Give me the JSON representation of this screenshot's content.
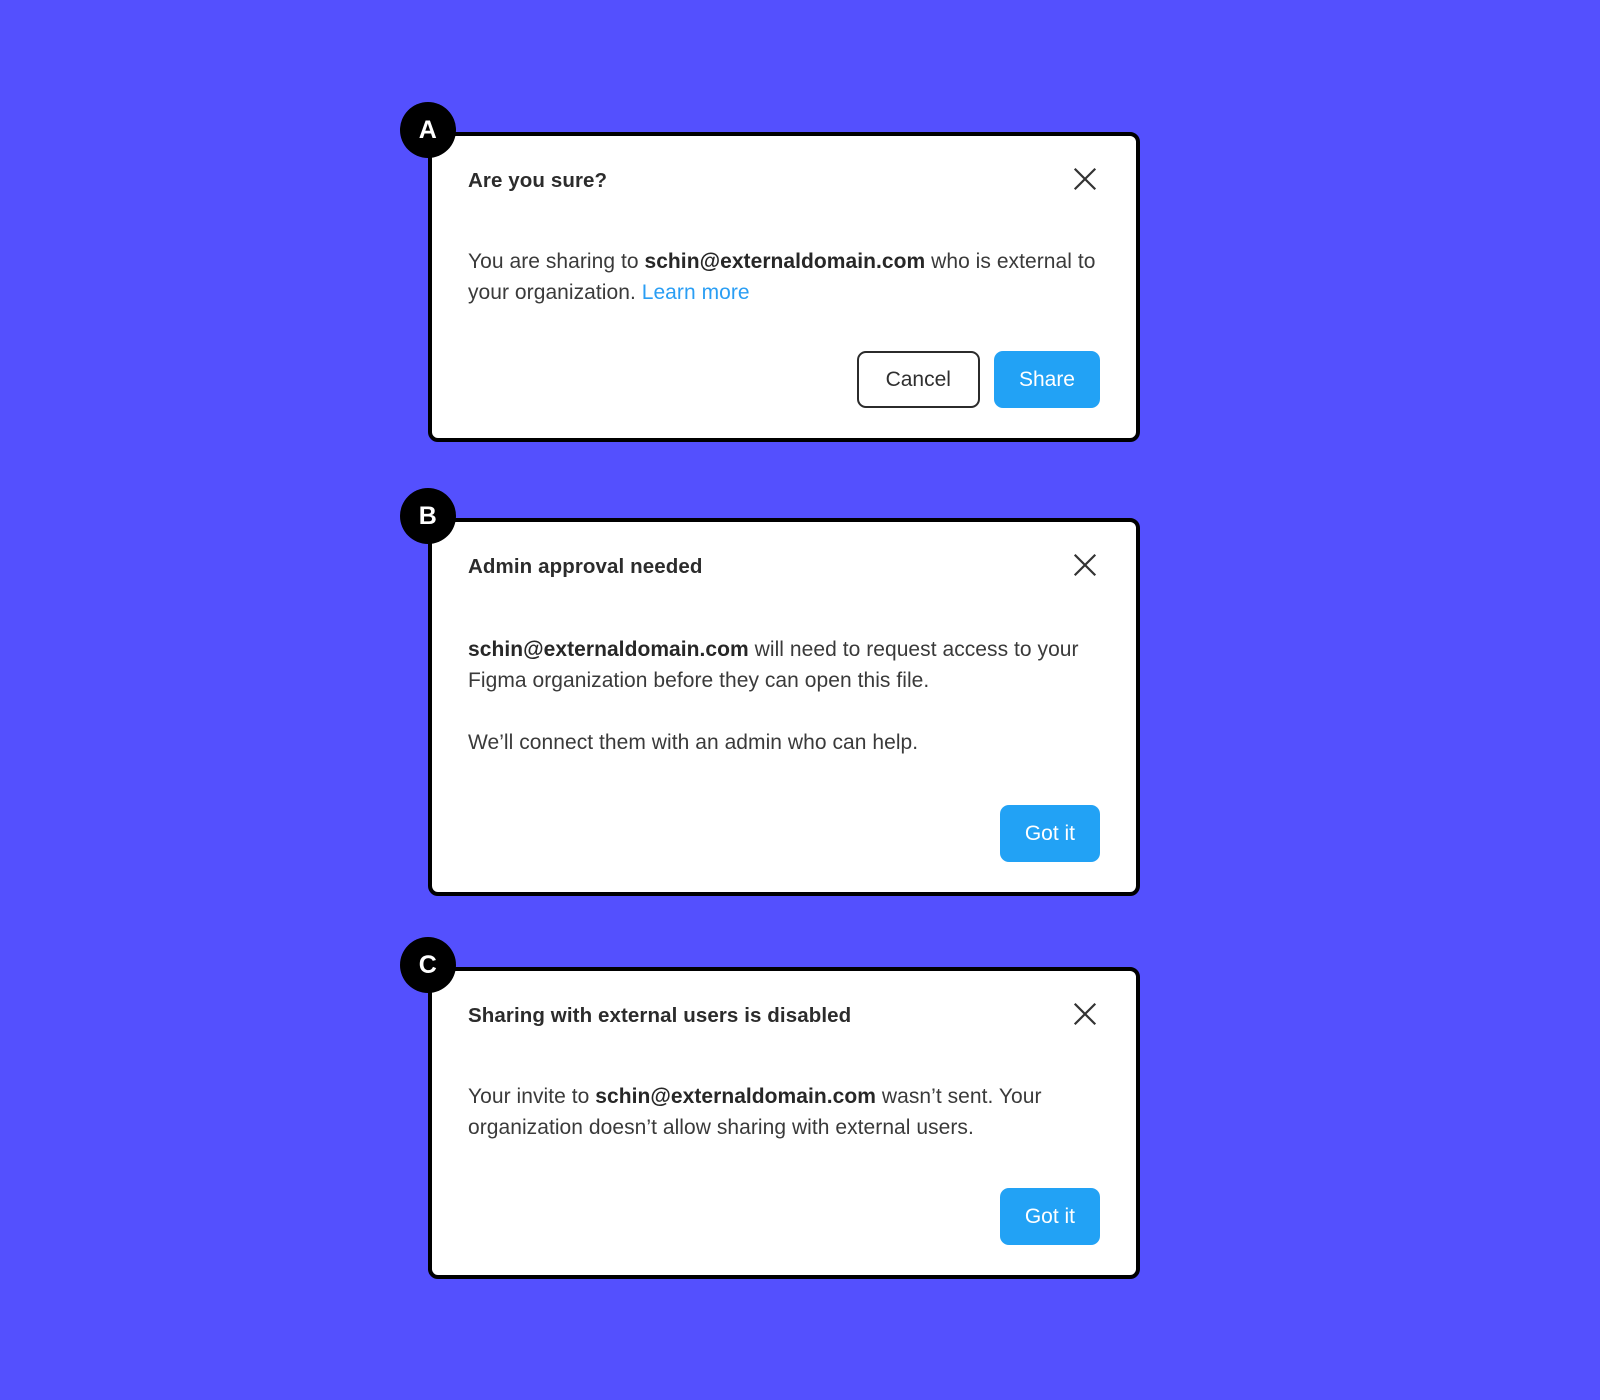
{
  "theme": {
    "background_color": "#5450fe",
    "card_background": "#ffffff",
    "card_border_color": "#000000",
    "badge_color": "#000000",
    "primary_button_color": "#22a2f5",
    "link_color": "#2a9ef4",
    "title_color": "#2c2c2c",
    "body_color": "#3a3a3a"
  },
  "dialogs": [
    {
      "badge": "A",
      "title": "Are you sure?",
      "close_icon": "close-icon",
      "body": {
        "lead": "You are sharing to ",
        "email": "schin@externaldomain.com",
        "tail": " who is external to your organization. ",
        "link_label": "Learn more"
      },
      "buttons": {
        "secondary_label": "Cancel",
        "primary_label": "Share"
      }
    },
    {
      "badge": "B",
      "title": "Admin approval needed",
      "close_icon": "close-icon",
      "body": {
        "email": "schin@externaldomain.com",
        "tail": " will need to request access to your Figma organization before they can open this file.",
        "paragraph2": "We’ll connect them with an admin who can help."
      },
      "buttons": {
        "primary_label": "Got it"
      }
    },
    {
      "badge": "C",
      "title": "Sharing with external users is disabled",
      "close_icon": "close-icon",
      "body": {
        "lead": "Your invite to ",
        "email": "schin@externaldomain.com",
        "tail": " wasn’t sent. Your organization doesn’t allow sharing with external users."
      },
      "buttons": {
        "primary_label": "Got it"
      }
    }
  ]
}
